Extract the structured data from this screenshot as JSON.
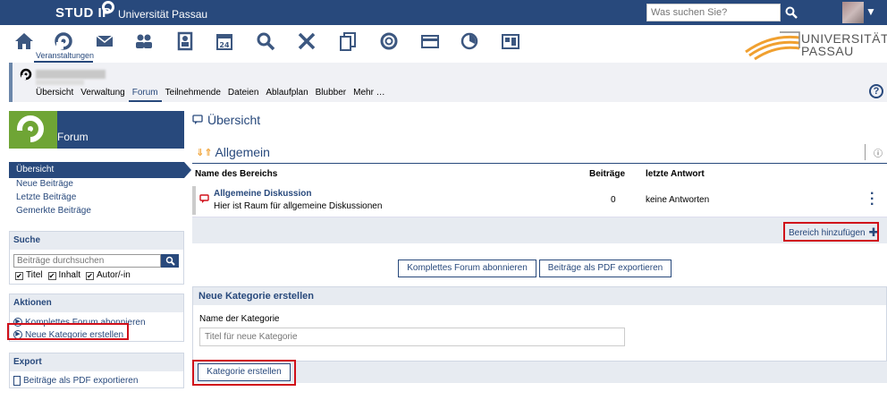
{
  "header": {
    "logo": "STUD IP",
    "university": "Universität Passau",
    "search_placeholder": "Was suchen Sie?"
  },
  "mainnav": {
    "active_label": "Veranstaltungen",
    "icons": [
      "home-icon",
      "seminar-icon",
      "mail-icon",
      "community-icon",
      "profile-icon",
      "calendar-icon",
      "search-icon",
      "tools-icon",
      "files-icon",
      "lifesaver-icon",
      "card-icon",
      "stats-icon",
      "dashboard-icon"
    ],
    "calendar_day": "24",
    "uni_logo_line1": "UNIVERSITÄT",
    "uni_logo_line2": "PASSAU"
  },
  "context": {
    "tabs": [
      "Übersicht",
      "Verwaltung",
      "Forum",
      "Teilnehmende",
      "Dateien",
      "Ablaufplan",
      "Blubber",
      "Mehr …"
    ],
    "active_tab": "Forum",
    "help": "?"
  },
  "sidebar": {
    "header_title": "Forum",
    "menu": [
      "Übersicht",
      "Neue Beiträge",
      "Letzte Beiträge",
      "Gemerkte Beiträge"
    ],
    "search_title": "Suche",
    "search_placeholder": "Beiträge durchsuchen",
    "checks": [
      "Titel",
      "Inhalt",
      "Autor/-in"
    ],
    "actions_title": "Aktionen",
    "actions": [
      "Komplettes Forum abonnieren",
      "Neue Kategorie erstellen"
    ],
    "export_title": "Export",
    "export_item": "Beiträge als PDF exportieren"
  },
  "content": {
    "title": "Übersicht",
    "category": "Allgemein",
    "info": "ⓘ",
    "columns": [
      "Name des Bereichs",
      "Beiträge",
      "letzte Antwort"
    ],
    "rows": [
      {
        "title": "Allgemeine Diskussion",
        "desc": "Hier ist Raum für allgemeine Diskussionen",
        "count": "0",
        "last": "keine Antworten"
      }
    ],
    "add_area": "Bereich hinzufügen",
    "btn_subscribe": "Komplettes Forum abonnieren",
    "btn_export": "Beiträge als PDF exportieren",
    "newcat_title": "Neue Kategorie erstellen",
    "newcat_label": "Name der Kategorie",
    "newcat_placeholder": "Titel für neue Kategorie",
    "btn_create": "Kategorie erstellen"
  },
  "colors": {
    "brand": "#28497c",
    "green": "#6fa535",
    "highlight": "#d0101a",
    "panel": "#e7ebf1"
  }
}
